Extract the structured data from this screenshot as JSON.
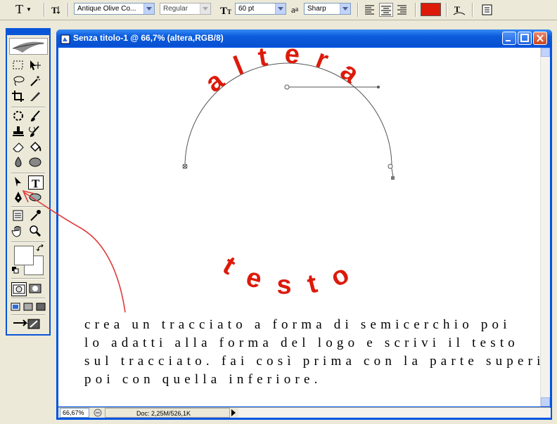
{
  "options_bar": {
    "tool_label": "T",
    "font_family": "Antique Olive Co...",
    "font_style": "Regular",
    "font_size": "60 pt",
    "aa_label": "a",
    "aa_small": "a",
    "antialias": "Sharp",
    "color": "#dd1a0a"
  },
  "document": {
    "title": "Senza titolo-1 @ 66,7% (altera,RGB/8)",
    "path_text_top": "altera",
    "path_text_bottom": "testo",
    "text_color": "#dd1a0a",
    "instructions": [
      "crea un tracciato a forma di semicerchio poi",
      "lo adatti alla forma del logo e scrivi il testo",
      "sul tracciato. fai così prima con la parte superiore",
      "poi con quella inferiore."
    ],
    "zoom": "66,67%",
    "doc_info": "Doc: 2,25M/526,1K"
  },
  "tools": {
    "selected_tool": "type-tool",
    "foreground_color": "#ffffff",
    "background_color": "#ffffff"
  },
  "annotation_color": "#e03a3a"
}
